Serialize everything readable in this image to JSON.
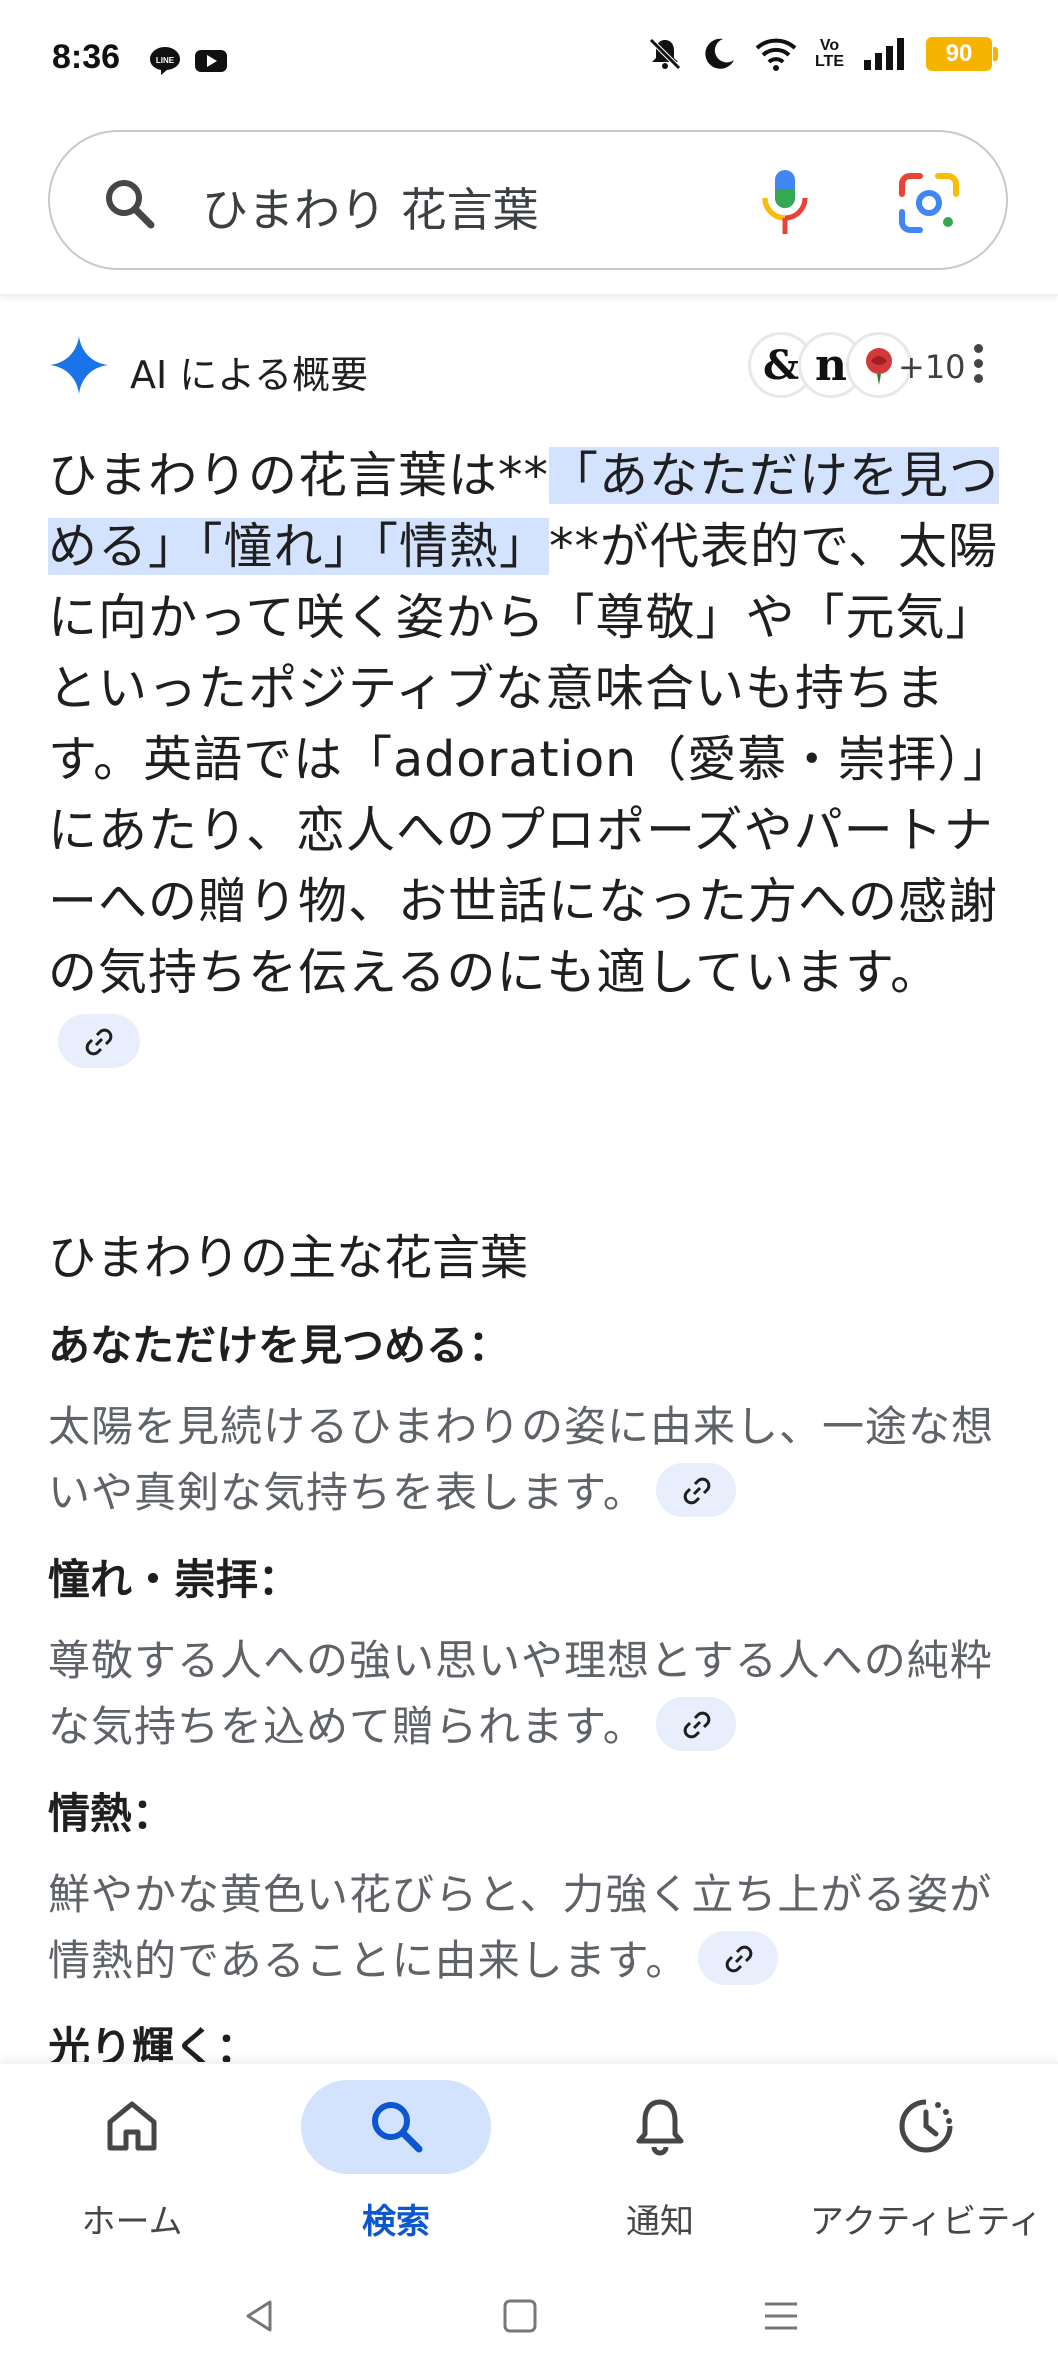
{
  "status_bar": {
    "time": "8:36",
    "app_icons": [
      "line-icon",
      "youtube-icon"
    ],
    "right_icons": [
      "mute-icon",
      "do-not-disturb-moon-icon",
      "wifi-icon",
      "volte-icon",
      "signal-icon"
    ],
    "volte_label_top": "Vo",
    "volte_label_bottom": "LTE",
    "battery": "90",
    "battery_color": "#f6b400"
  },
  "search": {
    "query": "ひまわり 花言葉",
    "icons": [
      "search-icon",
      "microphone-icon",
      "google-lens-icon"
    ]
  },
  "ai_overview": {
    "title": "AI による概要",
    "sources_more": "+10",
    "source_icons": [
      "ampersand-logo",
      "n-logo",
      "rose-logo"
    ],
    "source_labels": [
      "&",
      "n"
    ],
    "accent_color": "#1a73e8",
    "paragraph": {
      "before": "ひまわりの花言葉は**",
      "highlight": "「あなただけを見つめる」「憧れ」「情熱」",
      "after": "**が代表的で、太陽に向かって咲く姿から「尊敬」や「元気」といったポジティブな意味合いも持ちます。英語では「adoration（愛慕・崇拝）」にあたり、恋人へのプロポーズやパートナーへの贈り物、お世話になった方への感謝の気持ちを伝えるのにも適しています。"
    },
    "section_title": "ひまわりの主な花言葉",
    "items": [
      {
        "title": "あなただけを見つめる：",
        "desc": "太陽を見続けるひまわりの姿に由来し、一途な想いや真剣な気持ちを表します。"
      },
      {
        "title": "憧れ・崇拝：",
        "desc": "尊敬する人への強い思いや理想とする人への純粋な気持ちを込めて贈られます。"
      },
      {
        "title": "情熱：",
        "desc": "鮮やかな黄色い花びらと、力強く立ち上がる姿が情熱的であることに由来します。"
      },
      {
        "title": "光り輝く：",
        "desc": ""
      }
    ]
  },
  "bottom_nav": {
    "items": [
      {
        "label": "ホーム",
        "icon": "home-icon",
        "active": false
      },
      {
        "label": "検索",
        "icon": "search-icon",
        "active": true
      },
      {
        "label": "通知",
        "icon": "bell-icon",
        "active": false
      },
      {
        "label": "アクティビティ",
        "icon": "activity-icon",
        "active": false
      }
    ],
    "active_color": "#0b57d0"
  },
  "system_nav": [
    "back-icon",
    "home-square-icon",
    "menu-icon"
  ]
}
